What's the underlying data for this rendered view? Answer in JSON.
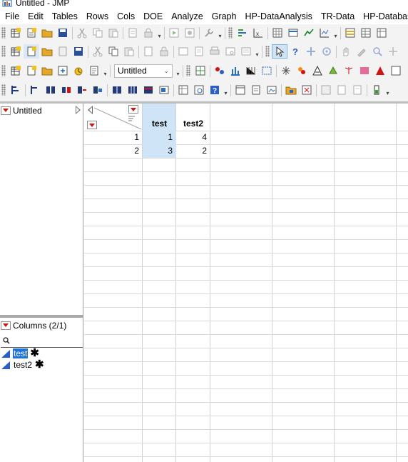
{
  "window": {
    "title": "Untitled - JMP"
  },
  "menubar": [
    "File",
    "Edit",
    "Tables",
    "Rows",
    "Cols",
    "DOE",
    "Analyze",
    "Graph",
    "HP-DataAnalysis",
    "TR-Data",
    "HP-Database"
  ],
  "toolbar": {
    "table_combo_value": "Untitled"
  },
  "left_panel": {
    "table_name": "Untitled",
    "columns_header": "Columns (2/1)",
    "columns": [
      {
        "name": "test",
        "selected": true,
        "icon": "continuous-column-icon",
        "marker": "✱"
      },
      {
        "name": "test2",
        "selected": false,
        "icon": "continuous-column-icon",
        "marker": "✱"
      }
    ]
  },
  "grid": {
    "headers": [
      "test",
      "test2"
    ],
    "rows": [
      {
        "row": "1",
        "cells": [
          "1",
          "4"
        ]
      },
      {
        "row": "2",
        "cells": [
          "3",
          "2"
        ]
      }
    ]
  },
  "colors": {
    "selection": "#1e73d8",
    "selected_cells": "#cfe4f7",
    "red_arrow": "#d01414"
  }
}
